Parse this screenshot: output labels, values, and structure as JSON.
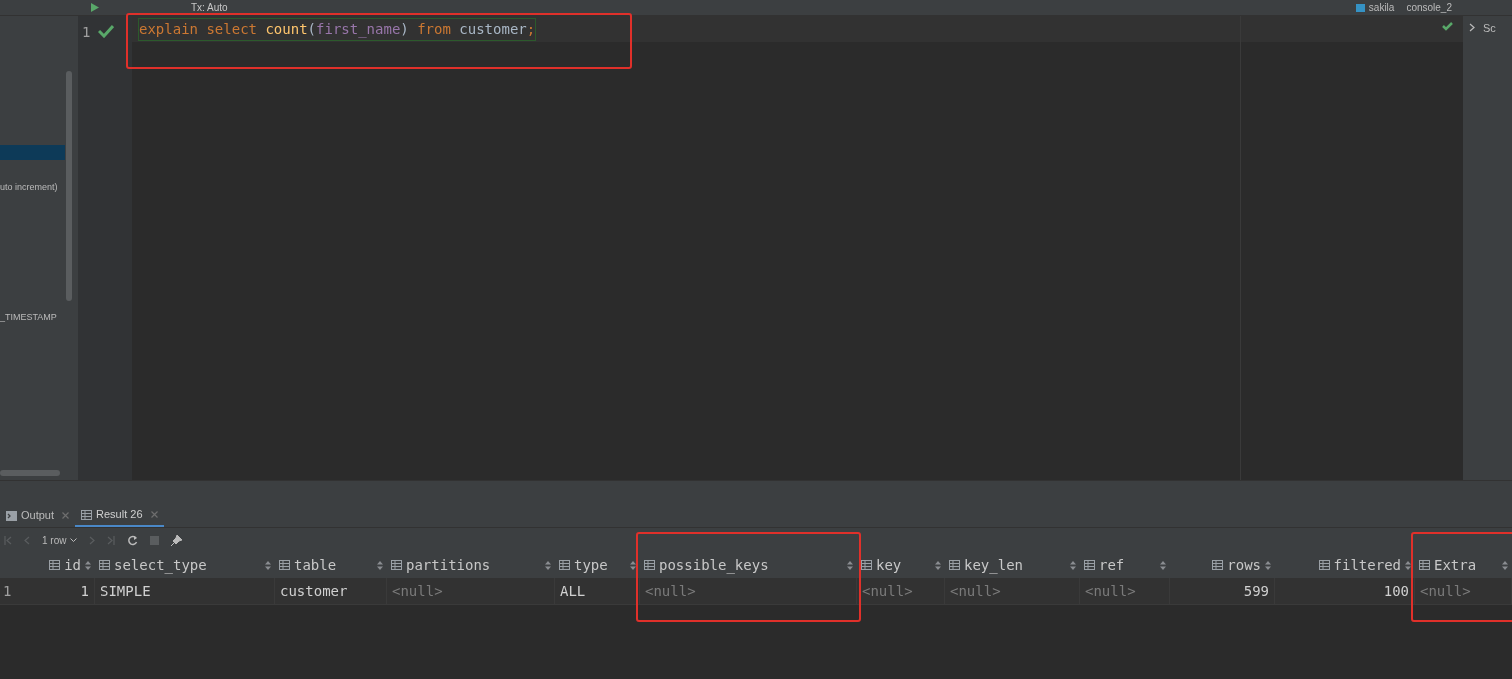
{
  "toolbar": {
    "transaction": "Tx: Auto",
    "schema": "sakila",
    "console": "console_2"
  },
  "sidebar": {
    "items": [
      {
        "selected": true
      },
      {
        "label": "uto increment)",
        "selected": false
      },
      {
        "label": "_TIMESTAMP",
        "selected": false
      }
    ]
  },
  "right_panel": {
    "label": "Sc"
  },
  "editor": {
    "line_number": "1",
    "highlighted": true,
    "tokens": [
      {
        "text": "explain",
        "kind": "keyword",
        "spaced": false
      },
      {
        "text": "select",
        "kind": "keyword",
        "spaced": true
      },
      {
        "text": "count",
        "kind": "function",
        "spaced": true
      },
      {
        "text": "(",
        "kind": "punct",
        "spaced": false
      },
      {
        "text": "first_name",
        "kind": "field",
        "spaced": false
      },
      {
        "text": ")",
        "kind": "punct",
        "spaced": false
      },
      {
        "text": "from",
        "kind": "keyword",
        "spaced": true
      },
      {
        "text": "customer",
        "kind": "identifier",
        "spaced": true
      },
      {
        "text": ";",
        "kind": "keyword",
        "spaced": false
      }
    ]
  },
  "result_tabs": [
    {
      "label": "Output",
      "kind": "output",
      "selected": false
    },
    {
      "label": "Result 26",
      "kind": "result",
      "selected": true
    }
  ],
  "result_toolbar": {
    "row_count": "1 row"
  },
  "table": {
    "columns": [
      {
        "label": "id",
        "kind": "number",
        "highlighted": false
      },
      {
        "label": "select_type",
        "kind": "text",
        "highlighted": false
      },
      {
        "label": "table",
        "kind": "text",
        "highlighted": false
      },
      {
        "label": "partitions",
        "kind": "text",
        "highlighted": false
      },
      {
        "label": "type",
        "kind": "text",
        "highlighted": false
      },
      {
        "label": "possible_keys",
        "kind": "text",
        "highlighted": true
      },
      {
        "label": "key",
        "kind": "text",
        "highlighted": false
      },
      {
        "label": "key_len",
        "kind": "text",
        "highlighted": false
      },
      {
        "label": "ref",
        "kind": "text",
        "highlighted": false
      },
      {
        "label": "rows",
        "kind": "number",
        "highlighted": false
      },
      {
        "label": "filtered",
        "kind": "number",
        "highlighted": false
      },
      {
        "label": "Extra",
        "kind": "text",
        "highlighted": true
      }
    ],
    "rows": [
      {
        "number": "1",
        "cells": [
          {
            "text": "1",
            "null": false
          },
          {
            "text": "SIMPLE",
            "null": false
          },
          {
            "text": "customer",
            "null": false
          },
          {
            "text": "<null>",
            "null": true
          },
          {
            "text": "ALL",
            "null": false
          },
          {
            "text": "<null>",
            "null": true
          },
          {
            "text": "<null>",
            "null": true
          },
          {
            "text": "<null>",
            "null": true
          },
          {
            "text": "<null>",
            "null": true
          },
          {
            "text": "599",
            "null": false
          },
          {
            "text": "100",
            "null": false
          },
          {
            "text": "<null>",
            "null": true
          }
        ]
      }
    ]
  }
}
